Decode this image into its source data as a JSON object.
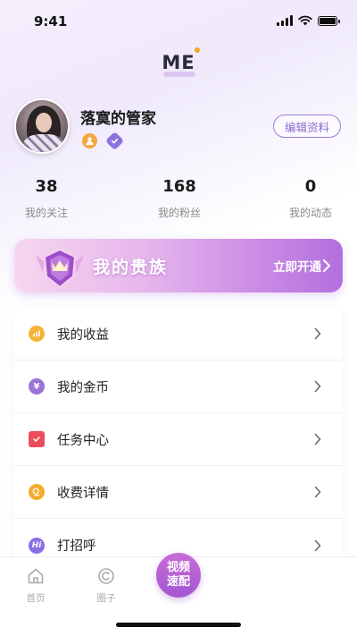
{
  "status_bar": {
    "time": "9:41"
  },
  "header": {
    "title": "ME"
  },
  "profile": {
    "nickname": "落寞的管家",
    "edit_label": "编辑资料",
    "badges": [
      "user-badge-icon",
      "verified-badge-icon"
    ]
  },
  "stats": [
    {
      "value": "38",
      "label": "我的关注"
    },
    {
      "value": "168",
      "label": "我的粉丝"
    },
    {
      "value": "0",
      "label": "我的动态"
    }
  ],
  "vip": {
    "title": "我的贵族",
    "cta": "立即开通"
  },
  "menu": [
    {
      "label": "我的收益",
      "icon": "earnings-icon",
      "color": "#f5b335"
    },
    {
      "label": "我的金币",
      "icon": "coin-icon",
      "color": "#9b73d8"
    },
    {
      "label": "任务中心",
      "icon": "task-icon",
      "color": "#ec4d5b"
    },
    {
      "label": "收费详情",
      "icon": "fee-icon",
      "color": "#f2ad2a"
    },
    {
      "label": "打招呼",
      "icon": "greeting-icon",
      "color": "#8a6ee6"
    }
  ],
  "tabs": [
    {
      "label": "首页",
      "icon": "home-icon"
    },
    {
      "label": "圈子",
      "icon": "circle-icon"
    }
  ],
  "center_action": {
    "line1": "视频",
    "line2": "速配"
  },
  "colors": {
    "accent": "#a456d0",
    "vip_gradient_end": "#b370de"
  }
}
